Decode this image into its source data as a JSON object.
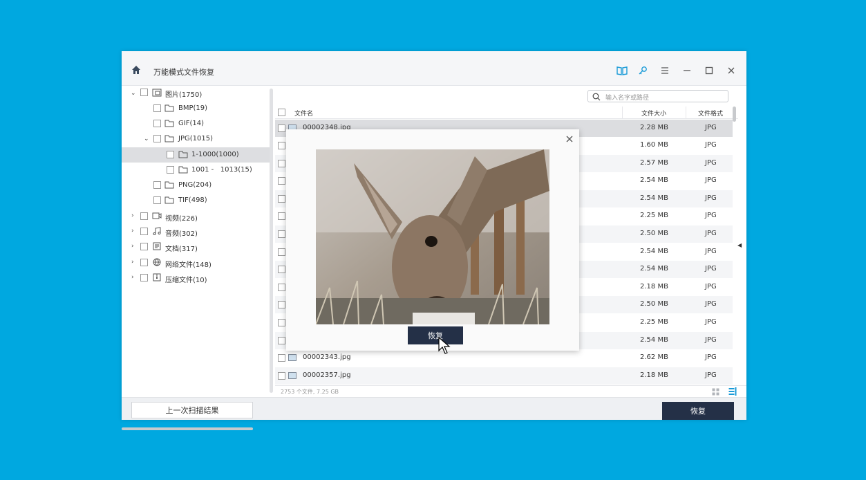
{
  "app": {
    "title": "万能模式文件恢复"
  },
  "toolbar": {
    "icons": [
      "home-icon",
      "book-icon",
      "key-icon",
      "menu-icon",
      "minimize-icon",
      "maximize-icon",
      "close-icon"
    ]
  },
  "tree": {
    "items": [
      {
        "label": "图片(1750)",
        "expanded": true
      },
      {
        "label": "BMP(19)"
      },
      {
        "label": "GIF(14)"
      },
      {
        "label": "JPG(1015)",
        "expanded": true
      },
      {
        "label": "1-1000(1000)",
        "selected": true
      },
      {
        "label": "1001 -   1013(15)"
      },
      {
        "label": "PNG(204)"
      },
      {
        "label": "TIF(498)"
      },
      {
        "label": "视频(226)"
      },
      {
        "label": "音频(302)"
      },
      {
        "label": "文档(317)"
      },
      {
        "label": "网络文件(148)"
      },
      {
        "label": "压缩文件(10)"
      }
    ]
  },
  "search": {
    "placeholder": "输入名字或路径"
  },
  "table": {
    "headers": {
      "name": "文件名",
      "size": "文件大小",
      "type": "文件格式"
    },
    "rows": [
      {
        "name": "00002348.jpg",
        "size": "2.28 MB",
        "type": "JPG"
      },
      {
        "name": "",
        "size": "1.60 MB",
        "type": "JPG"
      },
      {
        "name": "",
        "size": "2.57 MB",
        "type": "JPG"
      },
      {
        "name": "",
        "size": "2.54 MB",
        "type": "JPG"
      },
      {
        "name": "",
        "size": "2.54 MB",
        "type": "JPG"
      },
      {
        "name": "",
        "size": "2.25 MB",
        "type": "JPG"
      },
      {
        "name": "",
        "size": "2.50 MB",
        "type": "JPG"
      },
      {
        "name": "",
        "size": "2.54 MB",
        "type": "JPG"
      },
      {
        "name": "",
        "size": "2.54 MB",
        "type": "JPG"
      },
      {
        "name": "",
        "size": "2.18 MB",
        "type": "JPG"
      },
      {
        "name": "",
        "size": "2.50 MB",
        "type": "JPG"
      },
      {
        "name": "",
        "size": "2.25 MB",
        "type": "JPG"
      },
      {
        "name": "",
        "size": "2.54 MB",
        "type": "JPG"
      },
      {
        "name": "00002343.jpg",
        "size": "2.62 MB",
        "type": "JPG"
      },
      {
        "name": "00002357.jpg",
        "size": "2.18 MB",
        "type": "JPG"
      }
    ]
  },
  "status": {
    "summary": "2753 个文件, 7.25 GB"
  },
  "footer": {
    "prev_label": "上一次扫描结果",
    "recover_label": "恢复"
  },
  "preview": {
    "recover_label": "恢复"
  },
  "colors": {
    "background": "#00a8e0",
    "accent_dark": "#243047",
    "icon_blue": "#1a9bd7"
  }
}
